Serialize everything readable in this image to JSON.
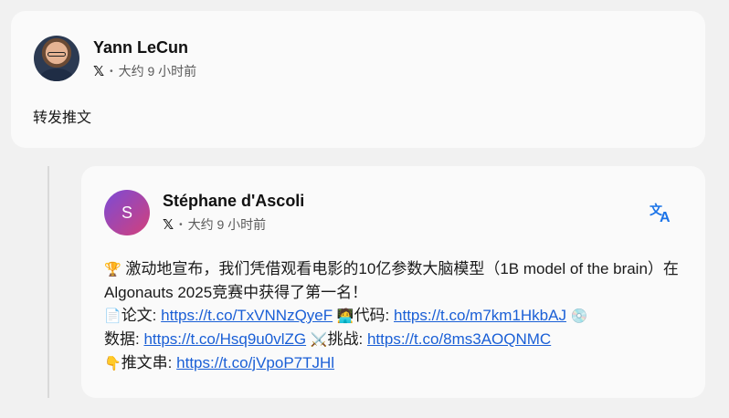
{
  "retweet": {
    "author_name": "Yann LeCun",
    "platform_icon": "x-logo",
    "platform_glyph": "𝕏",
    "separator": "•",
    "time": "大约 9 小时前",
    "body": "转发推文"
  },
  "quoted": {
    "avatar_letter": "S",
    "author_name": "Stéphane d'Ascoli",
    "platform_glyph": "𝕏",
    "separator": "•",
    "time": "大约 9 小时前",
    "translate_a": "文",
    "translate_b": "A",
    "line1_emoji": "🏆",
    "line1_text": " 激动地宣布，我们凭借观看电影的10亿参数大脑模型（1B model of the brain）在Algonauts 2025竞赛中获得了第一名！",
    "paper_emoji": "📄",
    "paper_label": "论文: ",
    "paper_link": "https://t.co/TxVNNzQyeF",
    "code_emoji": "🧑‍💻",
    "code_label": "代码: ",
    "code_link": "https://t.co/m7km1HkbAJ",
    "data_emoji": "💿",
    "data_label": "数据: ",
    "data_link": "https://t.co/Hsq9u0vlZG",
    "challenge_emoji": "⚔️",
    "challenge_label": "挑战: ",
    "challenge_link": "https://t.co/8ms3AOQNMC",
    "thread_emoji": "👇",
    "thread_label": "推文串: ",
    "thread_link": "https://t.co/jVpoP7TJHl"
  },
  "colors": {
    "link": "#1a5fd6",
    "translate": "#1a73e8"
  }
}
